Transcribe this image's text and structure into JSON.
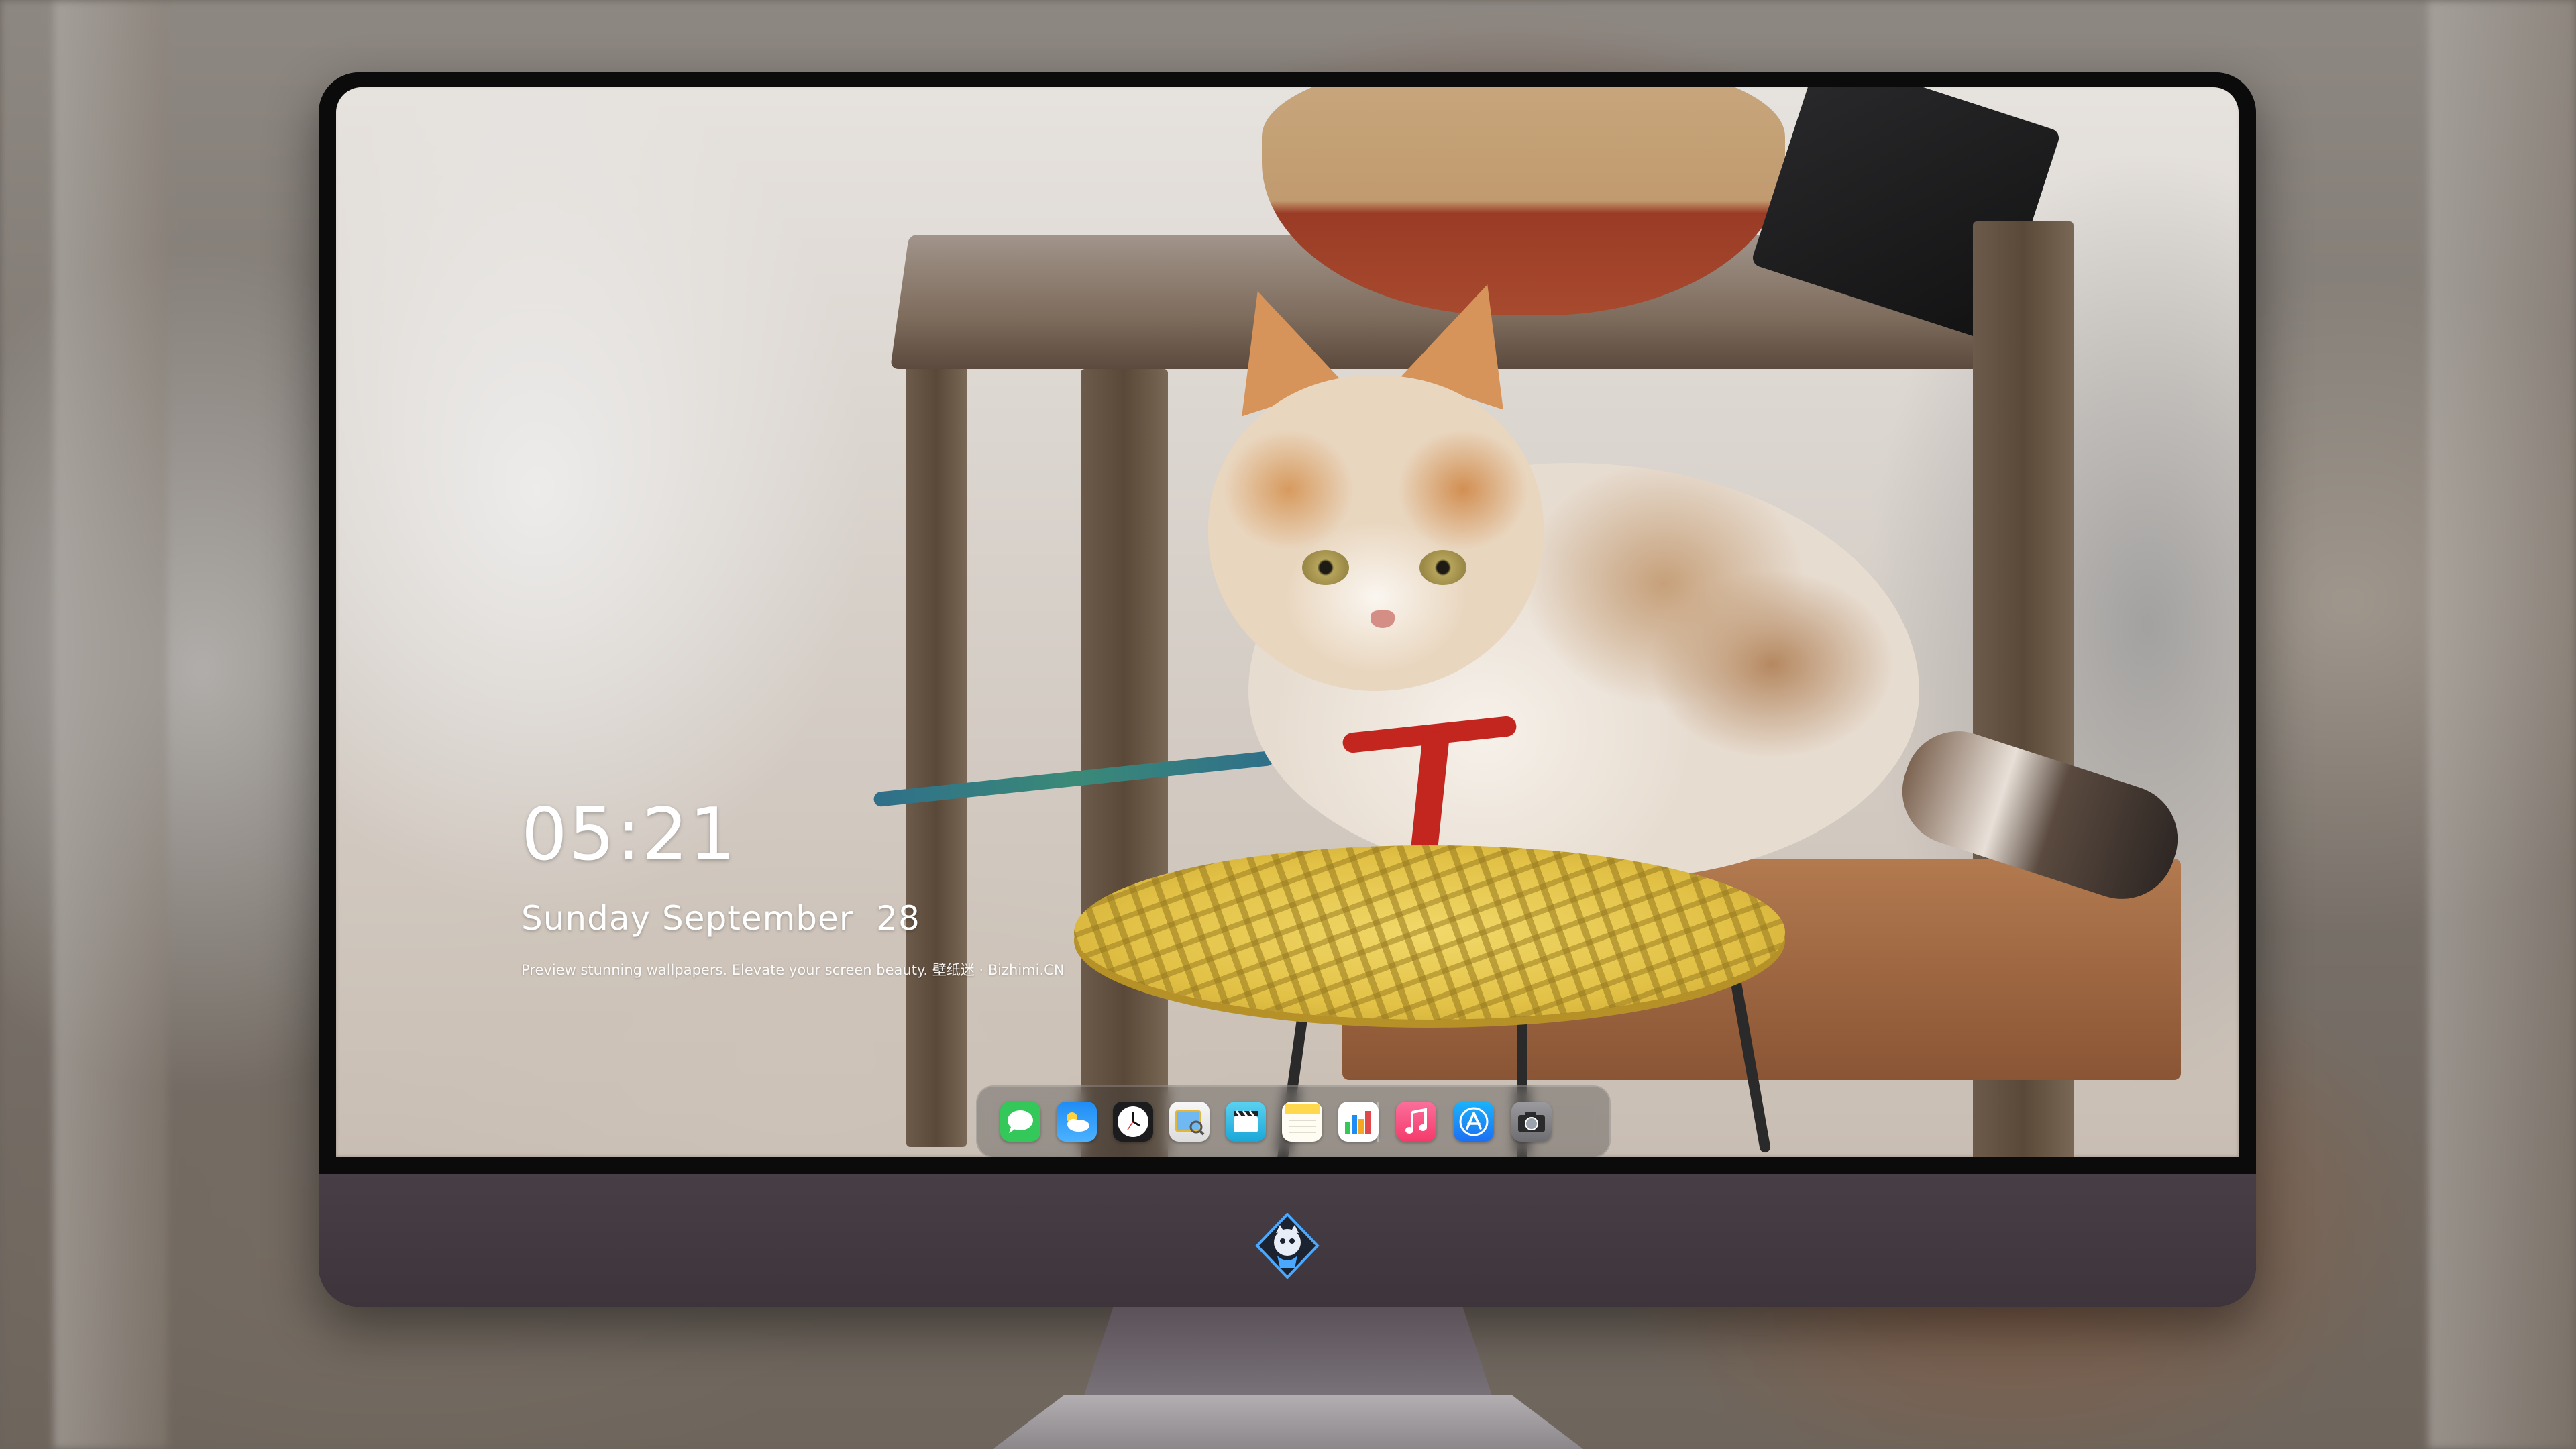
{
  "lock_screen": {
    "time": "05:21",
    "date": "Sunday September  28",
    "tagline": "Preview stunning wallpapers. Elevate your screen beauty. 壁纸迷 · Bizhimi.CN"
  },
  "dock": {
    "apps": [
      {
        "name": "messages-icon",
        "color": "#34c759"
      },
      {
        "name": "weather-icon",
        "color": "#1a7ff0"
      },
      {
        "name": "clock-icon",
        "color": "#ffffff"
      },
      {
        "name": "preview-icon",
        "color": "#f2c94c"
      },
      {
        "name": "clips-icon",
        "color": "#2cb6e0"
      },
      {
        "name": "notes-icon",
        "color": "#ffd84d"
      },
      {
        "name": "numbers-icon",
        "color": "#ffffff"
      },
      {
        "name": "music-icon",
        "color": "#f64a8a"
      },
      {
        "name": "app-store-icon",
        "color": "#1d8cf5"
      },
      {
        "name": "camera-icon",
        "color": "#8e8e93"
      }
    ]
  },
  "monitor": {
    "chin_logo": "mascot-logo-icon"
  }
}
